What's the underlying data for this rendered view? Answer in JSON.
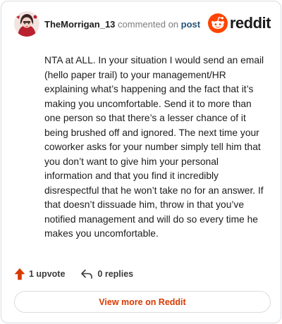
{
  "header": {
    "username": "TheMorrigan_13",
    "commented_text": "commented on",
    "post_link": "post",
    "logo_text": "reddit",
    "logo_color": "#ff4500"
  },
  "comment": {
    "body": "NTA at ALL. In your situation I would send an email (hello paper trail) to your management/HR explaining what’s happening and the fact that it’s making you uncomfortable. Send it to more than one person so that there’s a lesser chance of it being brushed off and ignored. The next time your coworker asks for your number simply tell him that you don’t want to give him your personal information and that you find it incredibly disrespectful that he won’t take no for an answer. If that doesn’t dissuade him, throw in that you’ve notified management and will do so every time he makes you uncomfortable."
  },
  "actions": {
    "upvotes_label": "1 upvote",
    "replies_label": "0 replies",
    "upvote_icon": "upvote-arrow-icon",
    "reply_icon": "reply-arrow-icon"
  },
  "footer": {
    "view_more_label": "View more on Reddit",
    "accent_color": "#d93900"
  }
}
